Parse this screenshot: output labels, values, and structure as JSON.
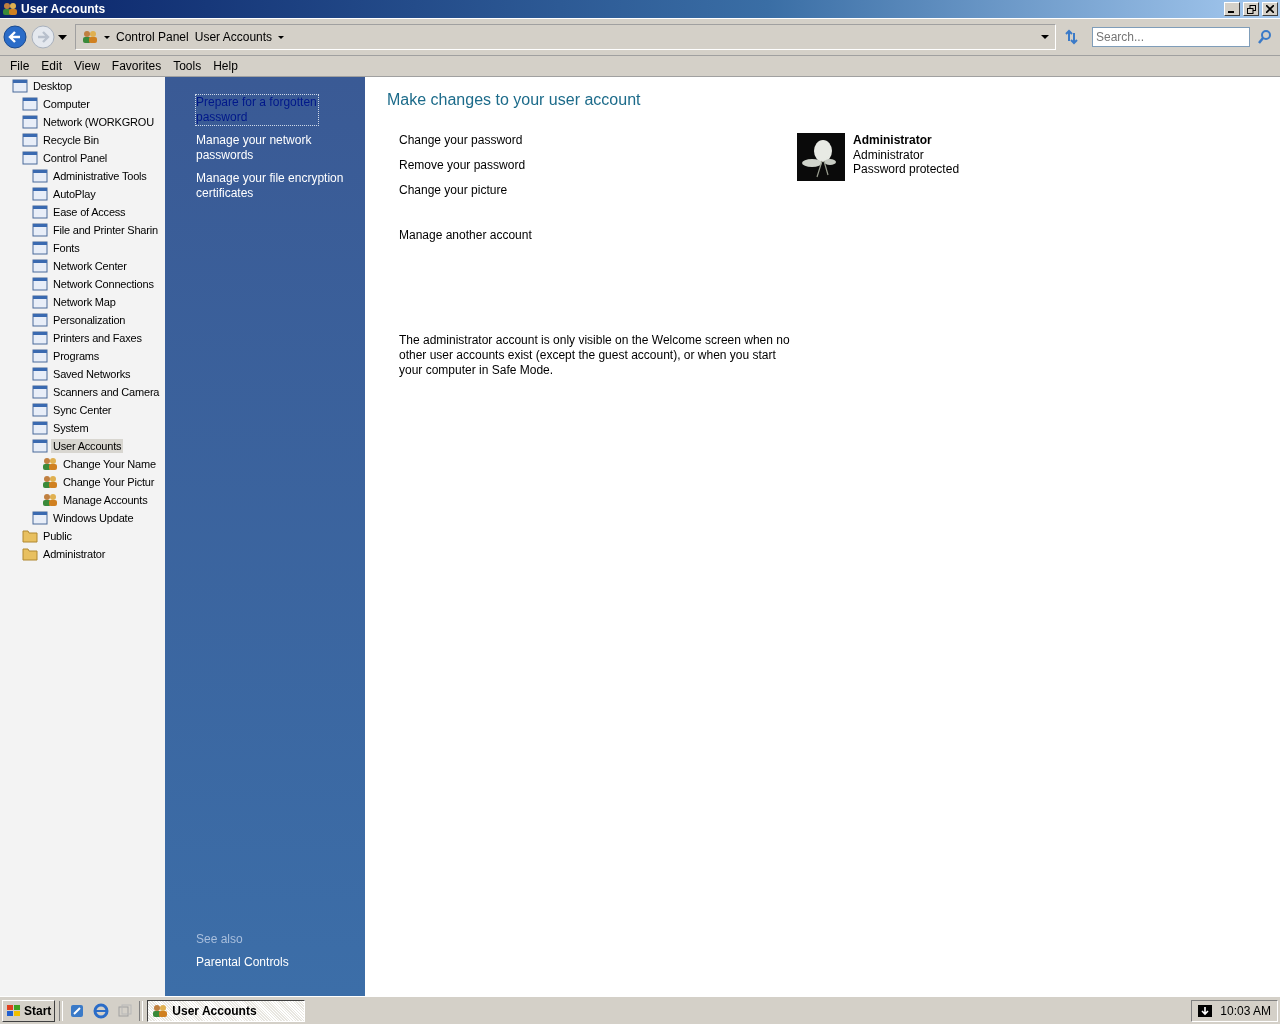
{
  "window": {
    "title": "User Accounts"
  },
  "address_bar": {
    "segments": [
      "Control Panel",
      "User Accounts"
    ],
    "search": {
      "placeholder": "Search..."
    }
  },
  "menu": [
    "File",
    "Edit",
    "View",
    "Favorites",
    "Tools",
    "Help"
  ],
  "tree": [
    {
      "label": "Desktop",
      "selected": false,
      "children": [
        {
          "label": "Computer",
          "selected": false
        },
        {
          "label": "Network (WORKGROU",
          "selected": false
        },
        {
          "label": "Recycle Bin",
          "selected": false
        },
        {
          "label": "Control Panel",
          "selected": false,
          "children": [
            {
              "label": "Administrative Tools",
              "selected": false
            },
            {
              "label": "AutoPlay",
              "selected": false
            },
            {
              "label": "Ease of Access",
              "selected": false
            },
            {
              "label": "File and Printer Sharin",
              "selected": false
            },
            {
              "label": "Fonts",
              "selected": false
            },
            {
              "label": "Network Center",
              "selected": false
            },
            {
              "label": "Network Connections",
              "selected": false
            },
            {
              "label": "Network Map",
              "selected": false
            },
            {
              "label": "Personalization",
              "selected": false
            },
            {
              "label": "Printers and Faxes",
              "selected": false
            },
            {
              "label": "Programs",
              "selected": false
            },
            {
              "label": "Saved Networks",
              "selected": false
            },
            {
              "label": "Scanners and Camera",
              "selected": false
            },
            {
              "label": "Sync Center",
              "selected": false
            },
            {
              "label": "System",
              "selected": false
            },
            {
              "label": "User Accounts",
              "selected": true,
              "children": [
                {
                  "label": "Change Your Name",
                  "selected": false
                },
                {
                  "label": "Change Your Pictur",
                  "selected": false
                },
                {
                  "label": "Manage Accounts",
                  "selected": false
                }
              ]
            },
            {
              "label": "Windows Update",
              "selected": false
            }
          ]
        },
        {
          "label": "Public",
          "selected": false
        },
        {
          "label": "Administrator",
          "selected": false
        }
      ]
    }
  ],
  "tasks_pane": {
    "links": [
      {
        "label": "Prepare for a forgotten password",
        "focused": true
      },
      {
        "label": "Manage your network passwords",
        "focused": false
      },
      {
        "label": "Manage your file encryption certificates",
        "focused": false
      }
    ],
    "see_also": {
      "title": "See also",
      "links": [
        "Parental Controls"
      ]
    }
  },
  "main": {
    "heading": "Make changes to your user account",
    "task_groups": [
      [
        "Change your password",
        "Remove your password",
        "Change your picture"
      ],
      [
        "Manage another account"
      ]
    ],
    "account": {
      "name": "Administrator",
      "type": "Administrator",
      "status": "Password protected"
    },
    "note": "The administrator account is only visible on the Welcome screen when no other user accounts exist (except the guest account), or when you start your computer in Safe Mode."
  },
  "taskbar": {
    "start": "Start",
    "tasks": [
      {
        "label": "User Accounts",
        "selected": true
      }
    ],
    "clock": "10:03 AM"
  }
}
